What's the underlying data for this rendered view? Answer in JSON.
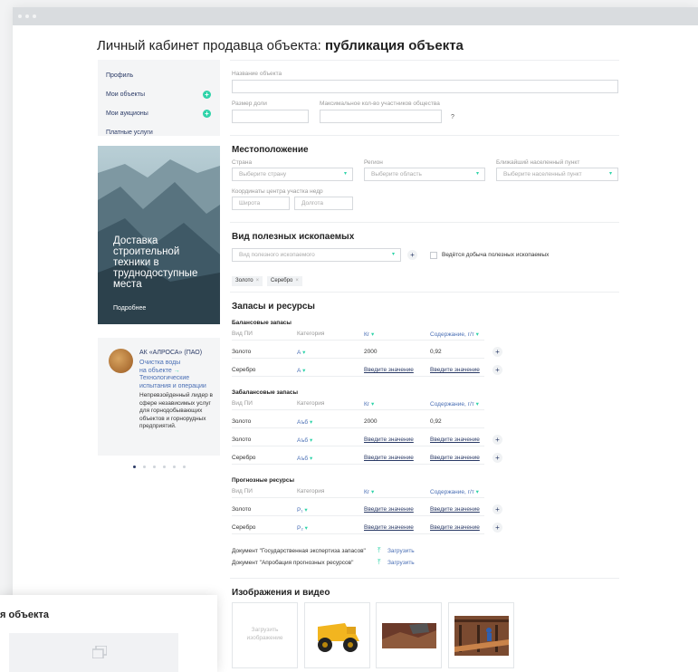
{
  "page_title_prefix": "Личный кабинет продавца объекта:",
  "page_title_bold": "публикация объекта",
  "sidebar": {
    "items": [
      {
        "label": "Профиль"
      },
      {
        "label": "Мои объекты",
        "action": "+"
      },
      {
        "label": "Мои аукционы",
        "action": "+"
      },
      {
        "label": "Платные услуги"
      }
    ]
  },
  "promo": {
    "text": "Доставка строительной техники в труднодоступные места",
    "link": "Подробнее"
  },
  "company_card": {
    "company": "АК «АЛРОСА» (ПАО)",
    "subtitle_line1": "Очистка воды",
    "subtitle_line2": "на объекте",
    "subtitle_line3": "Технологические испытания и операции",
    "body": "Непревзойденный лидер в сфере независимых услуг для горнодобывающих объектов и горнорудных предприятий."
  },
  "form": {
    "object_name_label": "Название объекта",
    "share_size_label": "Размер доли",
    "max_participants_label": "Максимальное кол-во участников общества",
    "help_mark": "?"
  },
  "location": {
    "heading": "Местоположение",
    "country_label": "Страна",
    "country_placeholder": "Выберите страну",
    "region_label": "Регион",
    "region_placeholder": "Выберите область",
    "settlement_label": "Ближайший населенный пункт",
    "settlement_placeholder": "Выберите населенный пункт",
    "coords_label": "Координаты центра участка недр",
    "lat_placeholder": "Широта",
    "lon_placeholder": "Долгота"
  },
  "minerals": {
    "heading": "Вид полезных ископаемых",
    "select_placeholder": "Вид полезного ископаемого",
    "add": "+",
    "mining_checkbox": "Ведётся добыча полезных ископаемых",
    "tags": [
      "Золото",
      "Серебро"
    ],
    "tag_remove": "×"
  },
  "reserves": {
    "heading": "Запасы и ресурсы",
    "col_mineral": "Вид ПИ",
    "col_category": "Категория",
    "col_kg": "Кг",
    "col_content": "Содержание, г/т",
    "enter_value": "Введите значение",
    "add": "+",
    "balance": {
      "title": "Балансовые запасы",
      "rows": [
        {
          "mineral": "Золото",
          "category": "А",
          "kg": "2000",
          "content": "0,92"
        },
        {
          "mineral": "Серебро",
          "category": "А",
          "kg": "",
          "content": ""
        }
      ]
    },
    "off_balance": {
      "title": "Забалансовые запасы",
      "rows": [
        {
          "mineral": "Золото",
          "category": "Аъб",
          "kg": "2000",
          "content": "0,92"
        },
        {
          "mineral": "Золото",
          "category": "Аъб",
          "kg": "",
          "content": ""
        },
        {
          "mineral": "Серебро",
          "category": "Аъб",
          "kg": "",
          "content": ""
        }
      ]
    },
    "forecast": {
      "title": "Прогнозные ресурсы",
      "rows": [
        {
          "mineral": "Золото",
          "category": "P₁",
          "kg": "",
          "content": ""
        },
        {
          "mineral": "Серебро",
          "category": "P₂",
          "kg": "",
          "content": ""
        }
      ]
    },
    "documents": [
      {
        "label": "Документ \"Государственная экспертиза запасов\"",
        "action": "Загрузить"
      },
      {
        "label": "Документ \"Апробация прогнозных ресурсов\"",
        "action": "Загрузить"
      }
    ]
  },
  "media": {
    "heading": "Изображения и видео",
    "upload_label": "Загрузить изображение"
  },
  "overlay": {
    "title": "я объекта"
  },
  "colors": {
    "accent": "#2fd3a9",
    "link": "#2a3a66",
    "brand_blue": "#4a6fb5"
  }
}
